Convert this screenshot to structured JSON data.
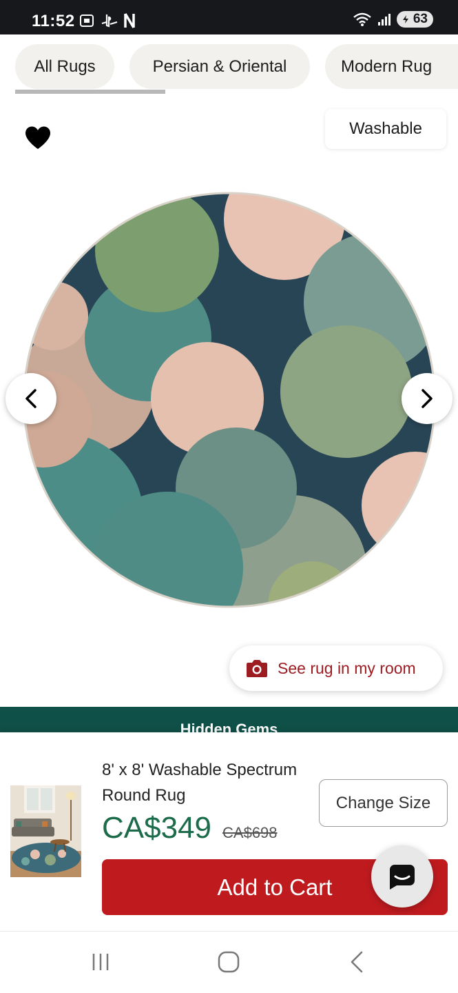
{
  "status_bar": {
    "time": "11:52",
    "battery": "63",
    "icons": [
      "screenshot-icon",
      "playstation-icon",
      "netflix-icon",
      "wifi-icon",
      "signal-icon",
      "battery-icon"
    ]
  },
  "categories": {
    "chips": [
      {
        "label": "All Rugs",
        "selected": true
      },
      {
        "label": "Persian & Oriental",
        "selected": false
      },
      {
        "label": "Modern Rug",
        "selected": false
      }
    ]
  },
  "gallery": {
    "badge": "Washable",
    "favorite_icon": "heart-icon",
    "prev_icon": "chevron-left-icon",
    "next_icon": "chevron-right-icon",
    "room_button": "See rug in my room"
  },
  "promo": {
    "text": "Hidden Gems"
  },
  "purchase": {
    "name": "8' x 8' Washable Spectrum Round Rug",
    "price": "CA$349",
    "original_price": "CA$698",
    "change_size_label": "Change Size",
    "add_to_cart_label": "Add to Cart"
  },
  "colors": {
    "accent_red": "#bf1b1f",
    "price_green": "#1c6b4a",
    "promo_teal": "#0f5148",
    "room_text": "#9c1c22"
  },
  "system_nav": {
    "icons": [
      "recents-icon",
      "home-icon",
      "back-icon"
    ]
  }
}
